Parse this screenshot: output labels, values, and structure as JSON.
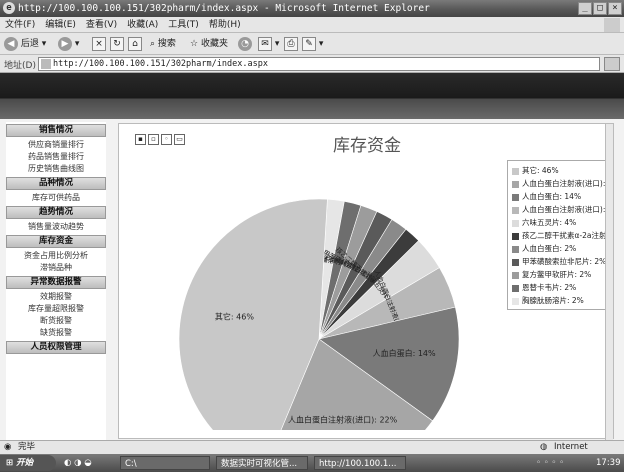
{
  "window": {
    "title": "http://100.100.100.151/302pharm/index.aspx - Microsoft Internet Explorer"
  },
  "menu": [
    "文件(F)",
    "编辑(E)",
    "查看(V)",
    "收藏(A)",
    "工具(T)",
    "帮助(H)"
  ],
  "toolbar": {
    "back": "后退",
    "search": "搜索",
    "favorites": "收藏夹"
  },
  "address": {
    "label": "地址(D)",
    "url": "http://100.100.100.151/302pharm/index.aspx"
  },
  "sidebar": [
    {
      "title": "销售情况",
      "items": [
        "供应商销量排行",
        "药品销售量排行",
        "历史销售曲线图"
      ]
    },
    {
      "title": "品种情况",
      "items": [
        "库存可供药品"
      ]
    },
    {
      "title": "趋势情况",
      "items": [
        "销售量波动趋势"
      ]
    },
    {
      "title": "库存资金",
      "items": [
        "资金占用比例分析",
        "滞销品种"
      ]
    },
    {
      "title": "异常数据报警",
      "items": [
        "效期报警",
        "库存量超限报警",
        "断货报警",
        "缺货报警"
      ]
    },
    {
      "title": "人员权限管理",
      "items": []
    }
  ],
  "main": {
    "title": "库存资金"
  },
  "chart_data": {
    "type": "pie",
    "title": "库存资金",
    "slices": [
      {
        "label": "其它",
        "value": 46,
        "display": "其它: 46%",
        "color": "#c8c8c8"
      },
      {
        "label": "人血白蛋白注射液(进口)",
        "value": 22,
        "display": "人血白蛋白注射液(进口): 22%",
        "color": "#a6a6a6"
      },
      {
        "label": "人血白蛋白",
        "value": 14,
        "display": "人血白蛋白: 14%",
        "color": "#7a7a7a"
      },
      {
        "label": "人血白蛋白注射液(进口)",
        "value": 5,
        "display": "人血白蛋白注射液(进口): 5%",
        "color": "#b8b8b8"
      },
      {
        "label": "六味五灵片",
        "value": 4,
        "display": "六味五灵片: 4%",
        "color": "#dcdcdc"
      },
      {
        "label": "孩乙二醇干扰素α-2a注射液",
        "value": 2,
        "display": "孩乙二醇干扰素α-2a注射液: 2%",
        "color": "#3c3c3c"
      },
      {
        "label": "人血白蛋白",
        "value": 2,
        "display": "人血白蛋白: 2%",
        "color": "#8a8a8a"
      },
      {
        "label": "甲苯磺酸索拉非尼片",
        "value": 2,
        "display": "甲苯磺酸索拉非尼片: 2%",
        "color": "#5a5a5a"
      },
      {
        "label": "复方鳖甲软肝片",
        "value": 2,
        "display": "复方鳖甲软肝片: 2%",
        "color": "#9c9c9c"
      },
      {
        "label": "恩替卡韦片",
        "value": 2,
        "display": "恩替卡韦片: 2%",
        "color": "#6e6e6e"
      },
      {
        "label": "胸腺肽肠溶片",
        "value": 2,
        "display": "胸腺肽肠溶片: 2%",
        "color": "#e6e6e6"
      }
    ],
    "legend_position": "right"
  },
  "status": {
    "left": "完毕",
    "zone": "Internet"
  },
  "taskbar": {
    "start": "开始",
    "tasks": [
      "C:\\",
      "数据实时可视化管...",
      "http://100.100.1..."
    ],
    "time": "17:39"
  }
}
